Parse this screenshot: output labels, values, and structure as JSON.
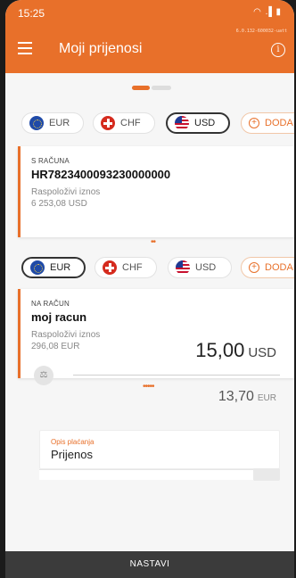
{
  "status": {
    "time": "15:25",
    "icons": "◠ .▌▮"
  },
  "appbar": {
    "title": "Moji prijenosi",
    "version": "6.0.132-600032-uatt",
    "menu_icon": "menu-icon",
    "info_icon": "info-icon",
    "info_glyph": "i"
  },
  "accent_color": "#e8702a",
  "from_currencies": [
    {
      "code": "EUR",
      "flag": "eur",
      "selected": false
    },
    {
      "code": "CHF",
      "flag": "chf",
      "selected": false
    },
    {
      "code": "USD",
      "flag": "usd",
      "selected": true
    },
    {
      "code": "DODA",
      "flag": "add",
      "selected": false
    }
  ],
  "from_account": {
    "header": "S RAČUNA",
    "number": "HR7823400093230000000",
    "available_label": "Raspoloživi iznos",
    "available_amount": "6 253,08 USD"
  },
  "to_currencies": [
    {
      "code": "EUR",
      "flag": "eur",
      "selected": true
    },
    {
      "code": "CHF",
      "flag": "chf",
      "selected": false
    },
    {
      "code": "USD",
      "flag": "usd",
      "selected": false
    },
    {
      "code": "DODA",
      "flag": "add",
      "selected": false
    }
  ],
  "to_account": {
    "header": "NA RAČUN",
    "name": "moj racun",
    "available_label": "Raspoloživi iznos",
    "available_amount": "296,08 EUR"
  },
  "pager": {
    "dots_from": "••",
    "dots_to": "•••••"
  },
  "amount": {
    "value": "15,00",
    "currency": "USD",
    "converted_value": "13,70",
    "converted_currency": "EUR",
    "exchange_icon_glyph": "⚖"
  },
  "description": {
    "label": "Opis plaćanja",
    "value": "Prijenos"
  },
  "footer": {
    "button": "NASTAVI"
  }
}
